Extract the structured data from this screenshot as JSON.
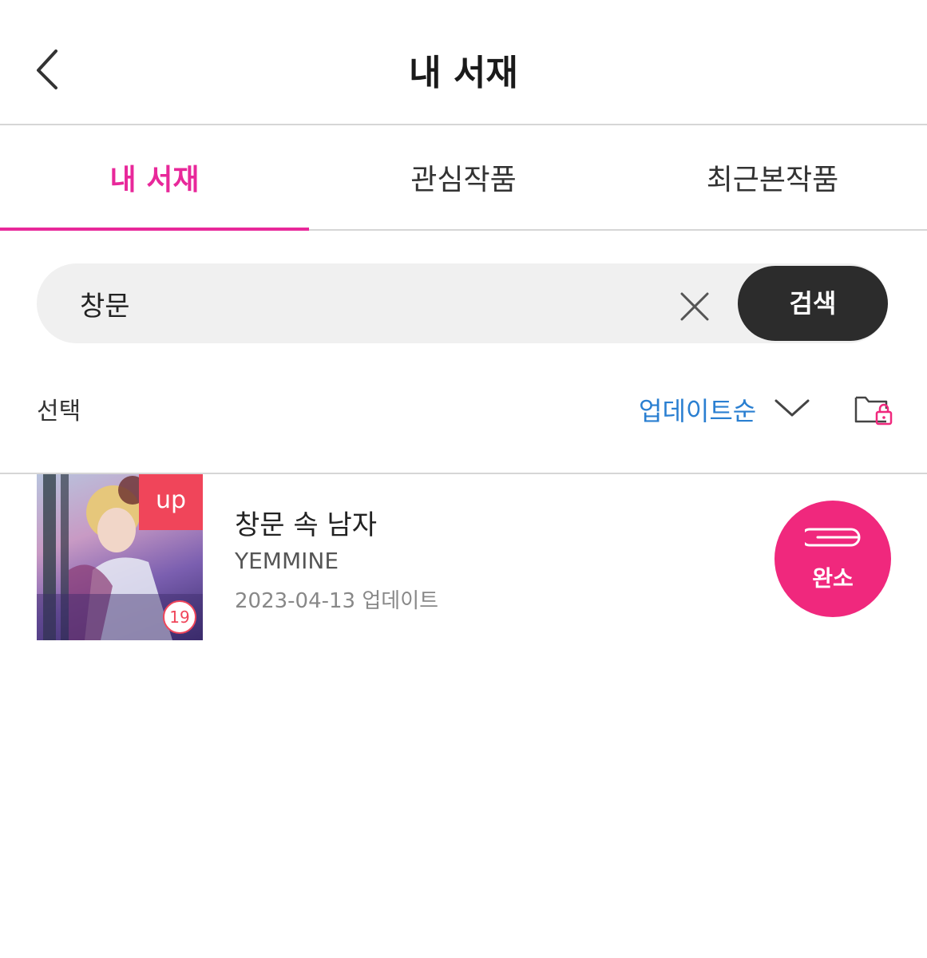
{
  "header": {
    "title": "내 서재",
    "back_icon": "chevron-left-icon"
  },
  "tabs": [
    {
      "label": "내 서재",
      "active": true
    },
    {
      "label": "관심작품",
      "active": false
    },
    {
      "label": "최근본작품",
      "active": false
    }
  ],
  "search": {
    "value": "창문",
    "clear_icon": "close-icon",
    "button_label": "검색"
  },
  "toolbar": {
    "select_label": "선택",
    "sort_label": "업데이트순",
    "sort_icon": "chevron-down-icon",
    "folder_icon": "lock-folder-icon"
  },
  "items": [
    {
      "title": "창문 속 남자",
      "author": "YEMMINE",
      "updated": "2023-04-13 업데이트",
      "badge": "up",
      "age_rating": "19",
      "action_label": "완소"
    }
  ],
  "colors": {
    "accent": "#e8289a",
    "sort": "#2a7fd1",
    "complete": "#f0287d",
    "search_button": "#2c2c2c",
    "up_badge": "#f0455a"
  }
}
